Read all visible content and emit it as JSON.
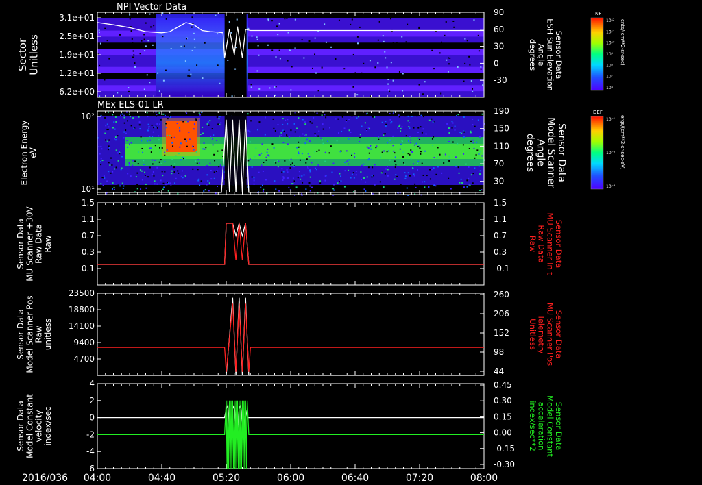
{
  "colors": {
    "background": "#000000",
    "axes": "#ffffff",
    "red_series": "#ff2020",
    "green_series": "#22ee22",
    "white_series": "#ffffff"
  },
  "x_axis": {
    "date_label": "2016/036",
    "range": [
      "04:00",
      "08:00"
    ],
    "ticks": [
      "04:00",
      "04:40",
      "05:20",
      "06:00",
      "06:40",
      "07:20",
      "08:00"
    ]
  },
  "chart_data": [
    {
      "type": "heatmap",
      "title": "NPI Vector Data",
      "ylabel": "Sector\nUnitless",
      "y_ticks": [
        "3.1e+01",
        "2.5e+01",
        "1.9e+01",
        "1.2e+01",
        "6.2e+00"
      ],
      "y2label": "Sensor Data\nESH Sun Elevation\nAngle\ndegrees",
      "y2_ticks": [
        "90",
        "60",
        "30",
        "0",
        "-30"
      ],
      "y2_range": [
        -60,
        90
      ],
      "colorbar": {
        "label": "NF",
        "unit": "cnts/(cm**2-sr-sec)",
        "ticks": [
          "10¹²",
          "10¹¹",
          "10¹⁰",
          "10⁹",
          "10⁸",
          "10⁷",
          "10⁶"
        ]
      },
      "overlay_series": [
        {
          "color": "#ffffff",
          "x": [
            "04:00",
            "04:10",
            "04:20",
            "04:30",
            "04:40",
            "04:45",
            "04:50",
            "04:55",
            "05:00",
            "05:05",
            "05:10",
            "05:15",
            "05:18",
            "05:19",
            "05:22",
            "05:25",
            "05:27",
            "05:30",
            "05:32",
            "05:35",
            "08:00"
          ],
          "y": [
            72,
            68,
            63,
            56,
            54,
            56,
            64,
            72,
            68,
            58,
            56,
            55,
            54,
            10,
            60,
            15,
            65,
            10,
            60,
            58,
            58
          ]
        }
      ]
    },
    {
      "type": "heatmap",
      "title": "MEx ELS-01 LR",
      "ylabel": "Electron Energy\neV",
      "y_ticks": [
        "10²",
        "10¹"
      ],
      "y2label": "Sensor Data\nModel Scanner\nAngle\ndegrees",
      "y2_ticks": [
        "190",
        "150",
        "110",
        "70",
        "30"
      ],
      "y2_range": [
        0,
        190
      ],
      "colorbar": {
        "label": "DEF",
        "unit": "ergs/(cm**2-sr-sec-eV)",
        "ticks": [
          "10⁻¹",
          "10⁻²",
          "10⁻³"
        ]
      },
      "overlay_series": [
        {
          "color": "#ffffff",
          "x": [
            "04:00",
            "05:17",
            "05:20",
            "05:22",
            "05:24",
            "05:26",
            "05:28",
            "05:30",
            "05:32",
            "05:34",
            "08:00"
          ],
          "y": [
            5,
            5,
            170,
            5,
            170,
            5,
            170,
            5,
            170,
            5,
            5
          ]
        }
      ]
    },
    {
      "type": "line",
      "ylabel": "Sensor Data\nMU Scanner +30V\nRaw Data\nRaw",
      "y_ticks": [
        "1.5",
        "1.1",
        "0.7",
        "0.3",
        "-0.1"
      ],
      "ylim": [
        -0.5,
        1.5
      ],
      "y2label": "Sensor Data\nMU Scanner Init\nRaw Data\nRaw",
      "y2_ticks": [
        "1.5",
        "1.1",
        "0.7",
        "0.3",
        "-0.1"
      ],
      "y2_color": "#ff2020",
      "series": [
        {
          "color": "#ffffff",
          "x": [
            "04:00",
            "05:19",
            "05:20",
            "05:24",
            "05:26",
            "05:28",
            "05:30",
            "05:32",
            "05:34",
            "08:00"
          ],
          "y": [
            0,
            0,
            1,
            1,
            0.7,
            1,
            0.7,
            1,
            0,
            0
          ]
        },
        {
          "color": "#ff2020",
          "x": [
            "04:00",
            "05:19",
            "05:20",
            "05:24",
            "05:26",
            "05:28",
            "05:30",
            "05:32",
            "05:34",
            "08:00"
          ],
          "y": [
            0,
            0,
            1,
            1,
            0.1,
            1,
            0.1,
            1,
            0,
            0
          ]
        }
      ]
    },
    {
      "type": "line",
      "ylabel": "Sensor Data\nModel Scanner Pos\nRaw\nunitless",
      "y_ticks": [
        "23500",
        "18800",
        "14100",
        "9400",
        "4700"
      ],
      "ylim": [
        0,
        23500
      ],
      "y2label": "Sensor Data\nMU Scanner Pos\nTelemetry\nUnitless",
      "y2_ticks": [
        "260",
        "206",
        "152",
        "98",
        "44"
      ],
      "y2_color": "#ff2020",
      "series": [
        {
          "color": "#ffffff",
          "x": [
            "04:00",
            "05:18",
            "05:20",
            "05:24",
            "05:26",
            "05:28",
            "05:30",
            "05:32",
            "05:34",
            "08:00"
          ],
          "y": [
            0,
            0,
            0,
            22200,
            0,
            22200,
            0,
            22200,
            0,
            0
          ]
        },
        {
          "color": "#ff2020",
          "x": [
            "04:00",
            "05:19",
            "05:20",
            "05:24",
            "05:26",
            "05:28",
            "05:30",
            "05:32",
            "05:34",
            "05:35",
            "08:00"
          ],
          "y": [
            8000,
            8000,
            1000,
            20500,
            1000,
            20500,
            1000,
            20500,
            1000,
            8000,
            8000
          ]
        }
      ]
    },
    {
      "type": "line",
      "ylabel": "Sensor Data\nModel Constant\nvelocity\nindex/sec",
      "y_ticks": [
        "4",
        "2",
        "0",
        "-2",
        "-4",
        "-6"
      ],
      "ylim": [
        -6,
        4
      ],
      "y2label": "Sensor Data\nModel Constant\nacceleration\nindex/sec**2",
      "y2_ticks": [
        "0.45",
        "0.30",
        "0.15",
        "0.00",
        "-0.15",
        "-0.30"
      ],
      "y2_color": "#22ee22",
      "series": [
        {
          "color": "#ffffff",
          "x": [
            "04:00",
            "05:19",
            "05:20",
            "05:21",
            "05:22",
            "05:23",
            "05:24",
            "05:25",
            "05:26",
            "05:27",
            "05:28",
            "05:29",
            "05:30",
            "05:31",
            "05:32",
            "05:33",
            "05:34",
            "08:00"
          ],
          "y": [
            0,
            0,
            1,
            1.5,
            -1,
            -2,
            1,
            1.5,
            -1,
            -2,
            1,
            1.5,
            -1,
            -2,
            1,
            0,
            0,
            0
          ]
        },
        {
          "color": "#22ee22",
          "x": [
            "04:00",
            "05:19",
            "05:20",
            "05:20.5",
            "05:21",
            "05:21.5",
            "05:22",
            "05:22.5",
            "05:23",
            "05:23.5",
            "05:24",
            "05:24.5",
            "05:25",
            "05:25.5",
            "05:26",
            "05:26.5",
            "05:27",
            "05:27.5",
            "05:28",
            "05:28.5",
            "05:29",
            "05:29.5",
            "05:30",
            "05:30.5",
            "05:31",
            "05:31.5",
            "05:32",
            "05:32.5",
            "05:33",
            "05:34",
            "08:00"
          ],
          "y": [
            -2,
            -2,
            2,
            -6,
            2,
            -6,
            2,
            -6,
            2,
            -6,
            2,
            -6,
            2,
            -6,
            2,
            -6,
            2,
            -6,
            2,
            -6,
            2,
            -6,
            2,
            -6,
            2,
            -6,
            2,
            -6,
            2,
            -2,
            -2
          ]
        }
      ]
    }
  ]
}
